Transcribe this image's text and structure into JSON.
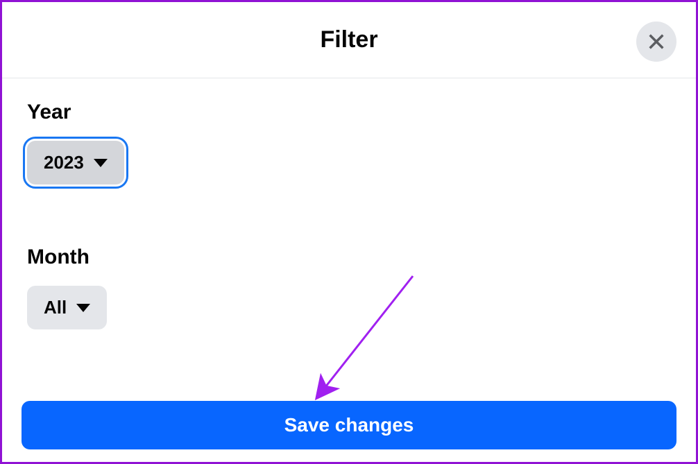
{
  "header": {
    "title": "Filter"
  },
  "year": {
    "label": "Year",
    "value": "2023"
  },
  "month": {
    "label": "Month",
    "value": "All"
  },
  "actions": {
    "save": "Save changes"
  }
}
